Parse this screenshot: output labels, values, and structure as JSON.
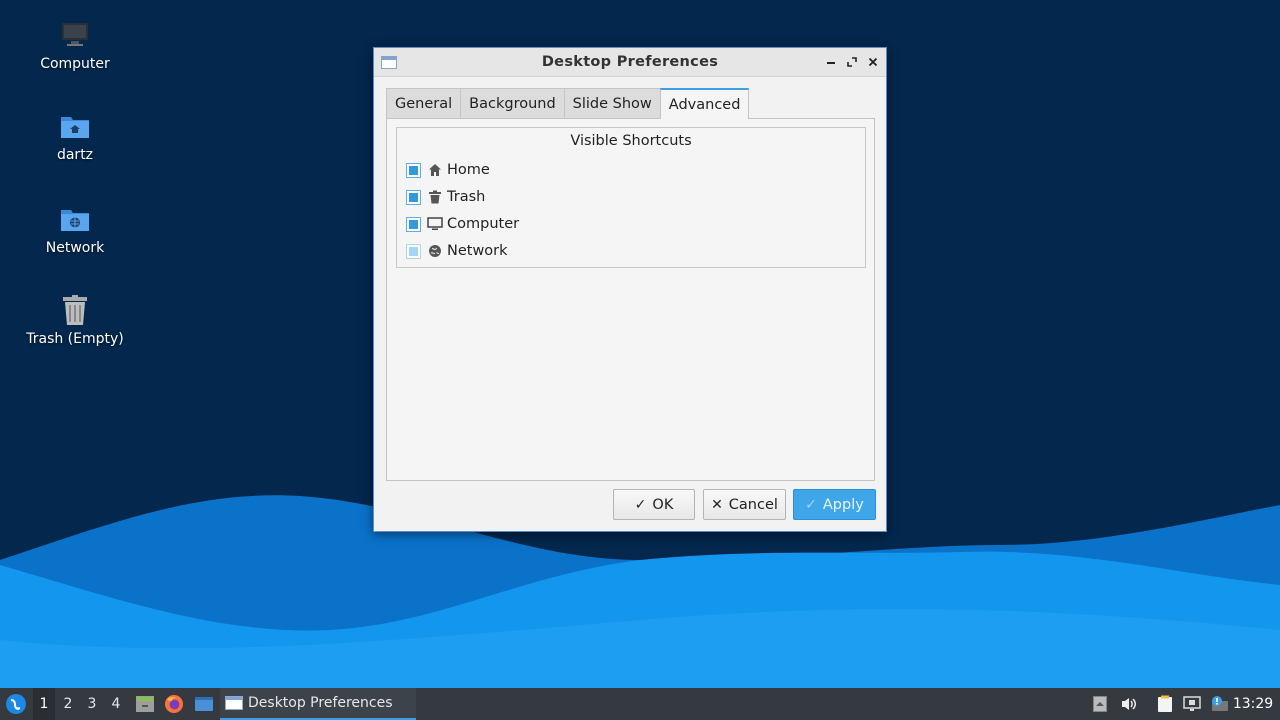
{
  "desktop": {
    "icons": [
      {
        "label": "Computer",
        "icon": "computer-icon"
      },
      {
        "label": "dartz",
        "icon": "home-folder-icon"
      },
      {
        "label": "Network",
        "icon": "network-folder-icon"
      },
      {
        "label": "Trash (Empty)",
        "icon": "trash-icon"
      }
    ]
  },
  "dialog": {
    "title": "Desktop Preferences",
    "tabs": [
      {
        "label": "General"
      },
      {
        "label": "Background"
      },
      {
        "label": "Slide Show"
      },
      {
        "label": "Advanced",
        "active": true
      }
    ],
    "group_title": "Visible Shortcuts",
    "shortcuts": [
      {
        "label": "Home",
        "checked": true,
        "icon": "home-icon"
      },
      {
        "label": "Trash",
        "checked": true,
        "icon": "trash-icon"
      },
      {
        "label": "Computer",
        "checked": true,
        "icon": "monitor-icon"
      },
      {
        "label": "Network",
        "checked": true,
        "dimmed": true,
        "icon": "globe-icon"
      }
    ],
    "buttons": {
      "ok": "OK",
      "cancel": "Cancel",
      "apply": "Apply"
    }
  },
  "taskbar": {
    "workspaces": [
      "1",
      "2",
      "3",
      "4"
    ],
    "active_workspace": "1",
    "window_task": "Desktop Preferences",
    "clock": "13:29"
  },
  "colors": {
    "accent": "#3d9ee4",
    "wallpaper_dark": "#03274d",
    "wave_light": "#1e9cf2",
    "taskbar": "#353a41"
  }
}
